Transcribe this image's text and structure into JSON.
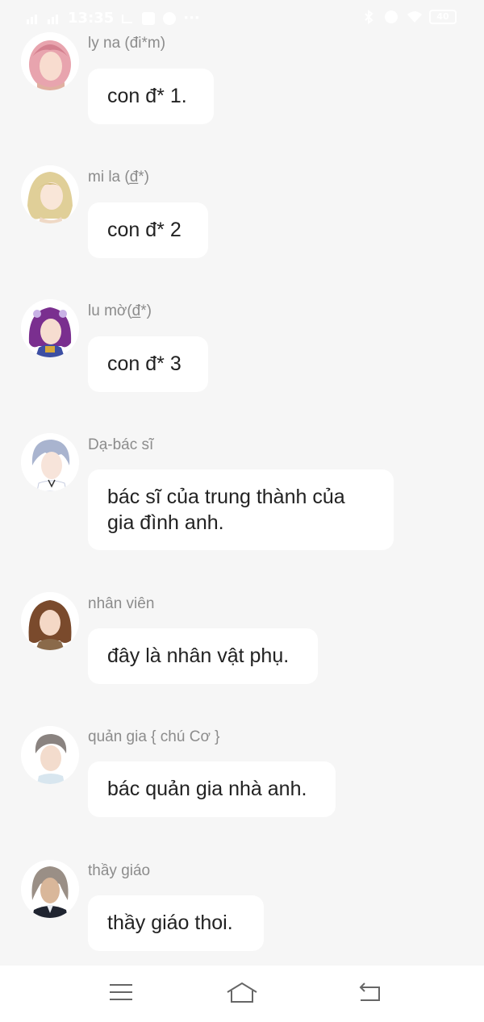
{
  "status_bar": {
    "time": "13:35",
    "battery": "40"
  },
  "messages": [
    {
      "name": "ly na (đi*m)",
      "text": "con đ* 1.",
      "avatar": "girl-pink-hair-avatar"
    },
    {
      "name": "mi la (đ̲*)",
      "text": "con đ* 2",
      "avatar": "girl-blonde-hair-avatar"
    },
    {
      "name": "lu mờ(đ̲*)",
      "text": "con đ* 3",
      "avatar": "girl-purple-hair-avatar"
    },
    {
      "name": "Dạ-bác sĩ",
      "text_lines": [
        "bác sĩ của trung thành của",
        "gia đình anh."
      ],
      "avatar": "man-silver-hair-avatar"
    },
    {
      "name": "nhân viên",
      "text": "đây là nhân vật phụ.",
      "avatar": "girl-brown-hair-avatar"
    },
    {
      "name": "quản gia { chú Cơ }",
      "text": "bác quản gia nhà anh.",
      "avatar": "man-gray-hair-avatar"
    },
    {
      "name": "thầy giáo",
      "text": "thầy giáo thoi.",
      "avatar": "man-long-hair-avatar"
    }
  ],
  "nav_bar": {
    "icons": [
      "menu-icon",
      "home-icon",
      "back-icon"
    ]
  }
}
